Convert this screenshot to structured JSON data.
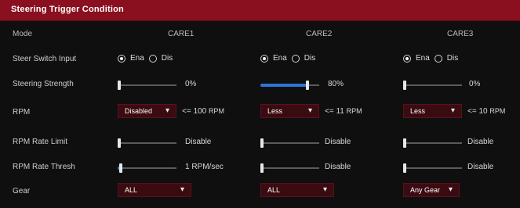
{
  "title": "Steering Trigger Condition",
  "columns": {
    "mode": "Mode",
    "c1": "CARE1",
    "c2": "CARE2",
    "c3": "CARE3"
  },
  "rows": {
    "r1": "Steer Switch Input",
    "r2": "Steering Strength",
    "r3": "RPM",
    "r4": "RPM Rate Limit",
    "r5": "RPM Rate Thresh",
    "r6": "Gear"
  },
  "radio_options": {
    "a": "Ena",
    "b": "Dis"
  },
  "steering_strength": [
    {
      "value_percent": 0,
      "text": "0%"
    },
    {
      "value_percent": 80,
      "text": "80%"
    },
    {
      "value_percent": 0,
      "text": "0%"
    }
  ],
  "rpm": [
    {
      "select": "Disabled",
      "op": "<=",
      "value": "100",
      "unit": "RPM"
    },
    {
      "select": "Less",
      "op": "<=",
      "value": "11",
      "unit": "RPM"
    },
    {
      "select": "Less",
      "op": "<=",
      "value": "10",
      "unit": "RPM"
    }
  ],
  "rpm_rate_limit": [
    {
      "value_percent": 0,
      "text": "Disable"
    },
    {
      "value_percent": 0,
      "text": "Disable"
    },
    {
      "value_percent": 0,
      "text": "Disable"
    }
  ],
  "rpm_rate_thresh": [
    {
      "value_percent": 5,
      "text": "1 RPM/sec"
    },
    {
      "value_percent": 0,
      "text": "Disable"
    },
    {
      "value_percent": 0,
      "text": "Disable"
    }
  ],
  "gear": [
    {
      "select": "ALL"
    },
    {
      "select": "ALL"
    },
    {
      "select": "Any Gear"
    }
  ],
  "colors": {
    "accent": "#8a1020",
    "dropdown": "#3b0b12",
    "slider_fill": "#2c74d6"
  }
}
